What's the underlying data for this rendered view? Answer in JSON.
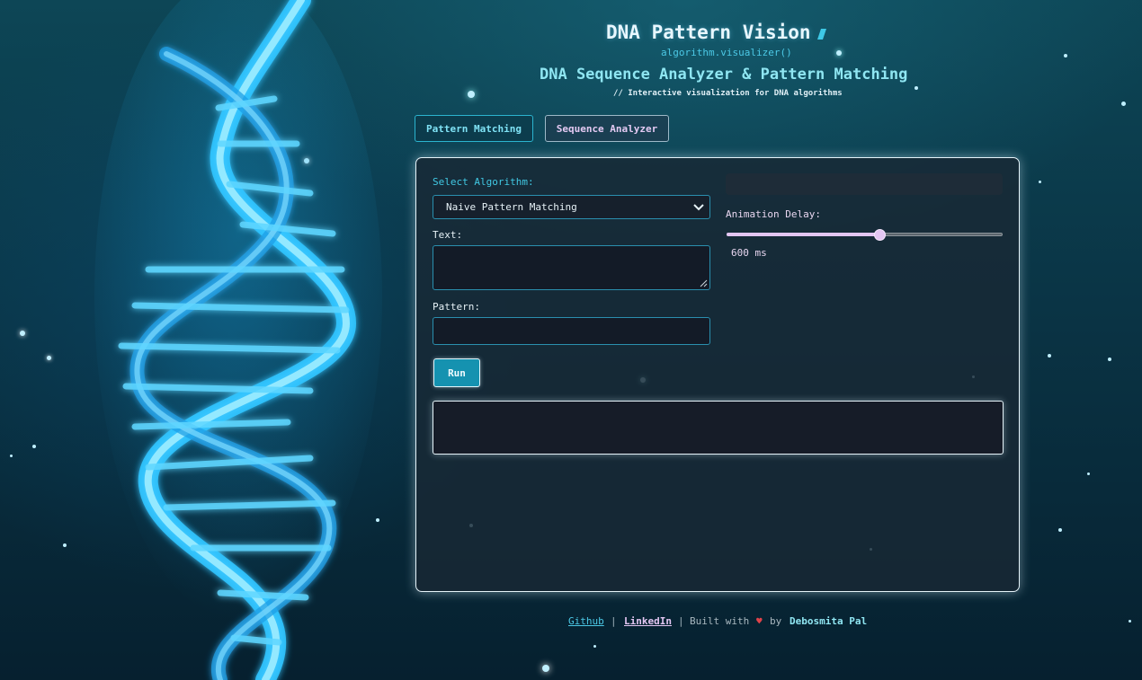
{
  "header": {
    "app_title": "DNA Pattern Vision",
    "subtitle_code": "algorithm.visualizer()",
    "main_heading": "DNA Sequence Analyzer & Pattern Matching",
    "tagline": "// Interactive visualization for DNA algorithms"
  },
  "tabs": [
    {
      "label": "Pattern Matching",
      "active": false
    },
    {
      "label": "Sequence Analyzer",
      "active": true
    }
  ],
  "form": {
    "algorithm_label": "Select Algorithm:",
    "algorithm_selected": "Naive Pattern Matching",
    "text_label": "Text:",
    "text_value": "",
    "pattern_label": "Pattern:",
    "pattern_value": "",
    "run_label": "Run"
  },
  "controls": {
    "delay_label": "Animation Delay:",
    "delay_value": "600 ms",
    "delay_slider_fraction": 0.55
  },
  "output": {
    "content": ""
  },
  "footer": {
    "github": "Github",
    "separator": "|",
    "linkedin": "LinkedIn",
    "built_with": "Built with",
    "heart": "♥",
    "by": "by",
    "author": "Debosmita Pal"
  },
  "colors": {
    "accent_cyan": "#41c9e4",
    "accent_lavender": "#e3c6f2",
    "run_button": "#1592b0",
    "heart": "#e0434a"
  }
}
